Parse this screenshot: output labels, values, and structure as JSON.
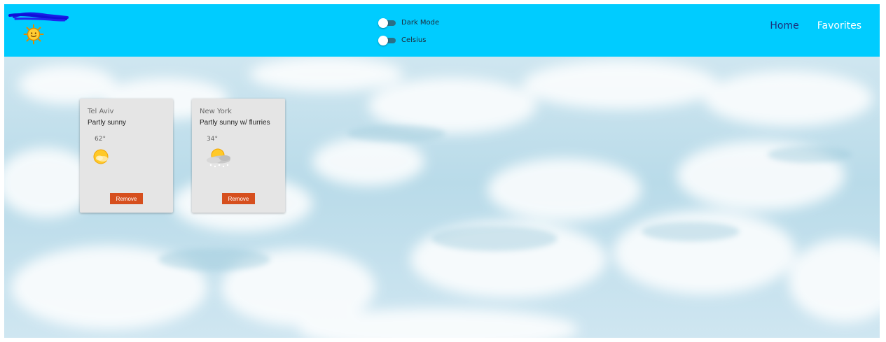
{
  "header": {
    "toggles": [
      {
        "label": "Dark Mode",
        "on": false
      },
      {
        "label": "Celsius",
        "on": false
      }
    ],
    "nav": {
      "home_label": "Home",
      "favorites_label": "Favorites"
    },
    "background_color": "#00ccff",
    "logo_icon": "sun-icon"
  },
  "favorites": [
    {
      "city": "Tel Aviv",
      "condition": "Partly sunny",
      "temperature": "62°",
      "icon": "partly-sunny-icon",
      "remove_label": "Remove"
    },
    {
      "city": "New York",
      "condition": "Partly sunny w/ flurries",
      "temperature": "34°",
      "icon": "partly-sunny-flurries-icon",
      "remove_label": "Remove"
    }
  ],
  "colors": {
    "remove_button": "#d64f1e",
    "home_link": "#1c2f7a",
    "card_background": "#e5e5e5"
  }
}
